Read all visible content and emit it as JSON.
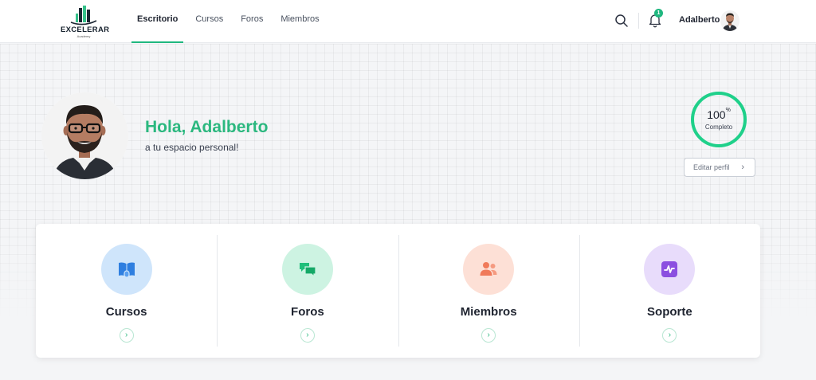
{
  "brand": {
    "name": "EXCELERAR",
    "tagline": "Academy"
  },
  "nav": {
    "items": [
      {
        "label": "Escritorio",
        "active": true
      },
      {
        "label": "Cursos",
        "active": false
      },
      {
        "label": "Foros",
        "active": false
      },
      {
        "label": "Miembros",
        "active": false
      }
    ]
  },
  "header": {
    "notification_count": "1",
    "username": "Adalberto"
  },
  "hero": {
    "greeting": "Hola, Adalberto",
    "subtitle": "a tu espacio personal!",
    "progress": {
      "value": "100",
      "unit": "%",
      "label": "Completo",
      "fraction": 1.0
    },
    "edit_label": "Editar perfil",
    "edit_chevron": "›"
  },
  "cards": [
    {
      "title": "Cursos",
      "icon": "book-icon",
      "arrow": "›",
      "bg": "#cfe5fb",
      "fg": "#2f7fe0"
    },
    {
      "title": "Foros",
      "icon": "chat-bubbles-icon",
      "arrow": "›",
      "bg": "#cdf3e2",
      "fg": "#1fbf7a"
    },
    {
      "title": "Miembros",
      "icon": "users-icon",
      "arrow": "›",
      "bg": "#fde0d6",
      "fg": "#f07a5a"
    },
    {
      "title": "Soporte",
      "icon": "activity-icon",
      "arrow": "›",
      "bg": "#e8dcfb",
      "fg": "#8b4fe0"
    }
  ],
  "colors": {
    "accent": "#2bb87f",
    "nav_underline": "#1fb77f",
    "progress_ring": "#1fd08a"
  }
}
